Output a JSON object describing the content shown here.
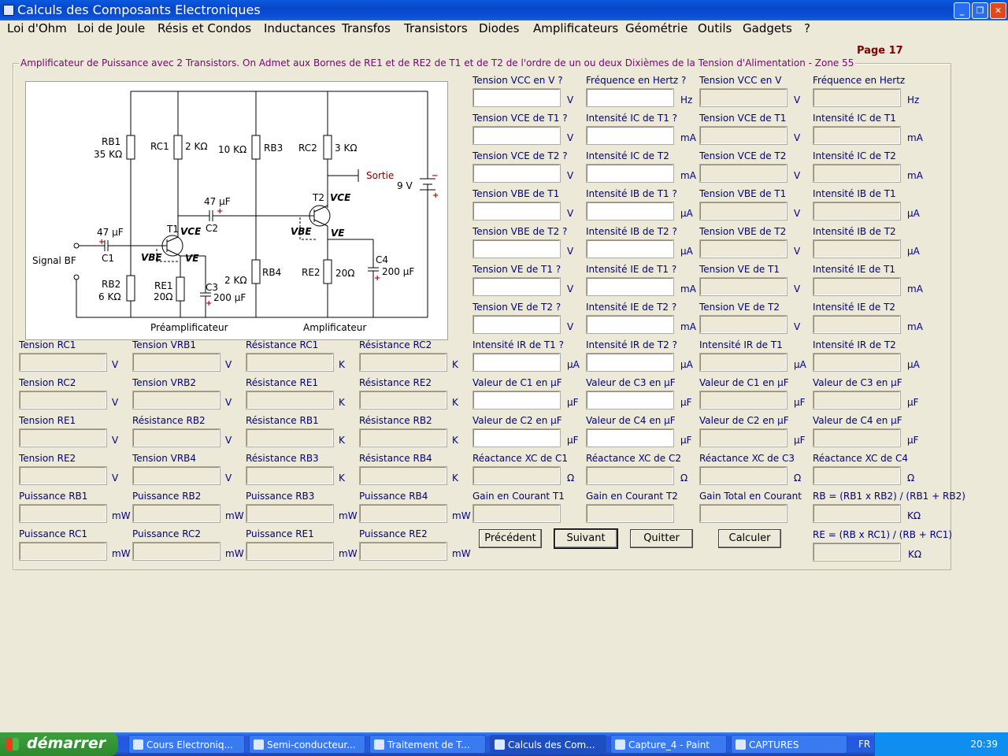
{
  "window": {
    "title": "Calculs des Composants Electroniques"
  },
  "menu": [
    "Loi d'Ohm",
    "Loi de Joule",
    "Résis et Condos",
    "Inductances",
    "Transfos",
    "Transistors",
    "Diodes",
    "Amplificateurs",
    "Géométrie",
    "Outils",
    "Gadgets",
    "?"
  ],
  "page_label": "Page 17",
  "group_title": "Amplificateur de Puissance avec 2 Transistors. On Admet aux Bornes de RE1 et de RE2 de T1 et de T2 de l'ordre de un ou deux Dixièmes de la Tension d'Alimentation - Zone 55",
  "circuit": {
    "labels": [
      "RB1",
      "35 KΩ",
      "RC1",
      "2 KΩ",
      "10 KΩ",
      "RB3",
      "RC2",
      "3 KΩ",
      "Sortie",
      "9 V",
      "T2",
      "VCE",
      "47 µF",
      "C2",
      "47 µF",
      "C1",
      "T1",
      "VCE",
      "VBE",
      "VE",
      "Signal BF",
      "RB2",
      "6 KΩ",
      "RE1",
      "20Ω",
      "C3",
      "200 µF",
      "2 KΩ",
      "RB4",
      "VBE",
      "VE",
      "RE2",
      "20Ω",
      "C4",
      "200 µF",
      "Préamplificateur",
      "Amplificateur"
    ]
  },
  "right_rows": [
    {
      "cells": [
        {
          "label": "Tension VCC en V ?",
          "unit": "V",
          "editable": true
        },
        {
          "label": "Fréquence en Hertz ?",
          "unit": "Hz",
          "editable": true
        },
        {
          "label": "Tension VCC en V",
          "unit": "V",
          "editable": false
        },
        {
          "label": "Fréquence en Hertz",
          "unit": "Hz",
          "editable": false
        }
      ]
    },
    {
      "cells": [
        {
          "label": "Tension VCE de T1 ?",
          "unit": "V",
          "editable": true
        },
        {
          "label": "Intensité IC de T1 ?",
          "unit": "mA",
          "editable": true
        },
        {
          "label": "Tension VCE de T1",
          "unit": "V",
          "editable": false
        },
        {
          "label": "Intensité IC de T1",
          "unit": "mA",
          "editable": false
        }
      ]
    },
    {
      "cells": [
        {
          "label": "Tension VCE de T2 ?",
          "unit": "V",
          "editable": true
        },
        {
          "label": "Intensité IC de T2",
          "unit": "mA",
          "editable": true
        },
        {
          "label": "Tension VCE de T2",
          "unit": "V",
          "editable": false
        },
        {
          "label": "Intensité IC de T2",
          "unit": "mA",
          "editable": false
        }
      ]
    },
    {
      "cells": [
        {
          "label": "Tension VBE de T1",
          "unit": "V",
          "editable": true
        },
        {
          "label": "Intensité IB de T1 ?",
          "unit": "µA",
          "editable": true
        },
        {
          "label": "Tension VBE de T1",
          "unit": "V",
          "editable": false
        },
        {
          "label": "Intensité IB de T1",
          "unit": "µA",
          "editable": false
        }
      ]
    },
    {
      "cells": [
        {
          "label": "Tension VBE de T2 ?",
          "unit": "V",
          "editable": true
        },
        {
          "label": "Intensité IB de T2 ?",
          "unit": "µA",
          "editable": true
        },
        {
          "label": "Tension VBE de T2",
          "unit": "V",
          "editable": false
        },
        {
          "label": "Intensité IB de T2",
          "unit": "µA",
          "editable": false
        }
      ]
    },
    {
      "cells": [
        {
          "label": "Tension VE de T1 ?",
          "unit": "V",
          "editable": true
        },
        {
          "label": "Intensité IE de T1 ?",
          "unit": "mA",
          "editable": true
        },
        {
          "label": "Tension VE de T1",
          "unit": "V",
          "editable": false
        },
        {
          "label": "Intensité IE de T1",
          "unit": "mA",
          "editable": false
        }
      ]
    },
    {
      "cells": [
        {
          "label": "Tension VE de T2 ?",
          "unit": "V",
          "editable": true
        },
        {
          "label": "Intensité IE de T2 ?",
          "unit": "mA",
          "editable": true
        },
        {
          "label": "Tension VE de T2",
          "unit": "V",
          "editable": false
        },
        {
          "label": "Intensité IE de T2",
          "unit": "mA",
          "editable": false
        }
      ]
    },
    {
      "cells": [
        {
          "label": "Intensité IR de T1 ?",
          "unit": "µA",
          "editable": true
        },
        {
          "label": "Intensité IR de T2 ?",
          "unit": "µA",
          "editable": true
        },
        {
          "label": "Intensité IR de T1",
          "unit": "µA",
          "editable": false
        },
        {
          "label": "Intensité IR de T2",
          "unit": "µA",
          "editable": false
        }
      ]
    },
    {
      "cells": [
        {
          "label": "Valeur de C1 en µF",
          "unit": "µF",
          "editable": true
        },
        {
          "label": "Valeur de C3 en µF",
          "unit": "µF",
          "editable": true
        },
        {
          "label": "Valeur de C1 en µF",
          "unit": "µF",
          "editable": false
        },
        {
          "label": "Valeur de C3 en µF",
          "unit": "µF",
          "editable": false
        }
      ]
    },
    {
      "cells": [
        {
          "label": "Valeur de C2 en µF",
          "unit": "µF",
          "editable": true
        },
        {
          "label": "Valeur de C4 en µF",
          "unit": "µF",
          "editable": true
        },
        {
          "label": "Valeur de C2 en µF",
          "unit": "µF",
          "editable": false
        },
        {
          "label": "Valeur de C4 en µF",
          "unit": "µF",
          "editable": false
        }
      ]
    },
    {
      "cells": [
        {
          "label": "Réactance XC de C1",
          "unit": "Ω",
          "editable": false
        },
        {
          "label": "Réactance XC de C2",
          "unit": "Ω",
          "editable": false
        },
        {
          "label": "Réactance XC de C3",
          "unit": "Ω",
          "editable": false
        },
        {
          "label": "Réactance XC de C4",
          "unit": "Ω",
          "editable": false
        }
      ]
    },
    {
      "cells": [
        {
          "label": "Gain en Courant T1",
          "unit": "",
          "editable": false
        },
        {
          "label": "Gain en Courant T2",
          "unit": "",
          "editable": false
        },
        {
          "label": "Gain Total en Courant",
          "unit": "",
          "editable": false
        },
        {
          "label": "RB =  (RB1 x RB2) / (RB1 + RB2)",
          "unit": "KΩ",
          "editable": false
        }
      ]
    }
  ],
  "re_formula": {
    "label": "RE = (RB x RC1) / (RB + RC1)",
    "unit": "KΩ"
  },
  "left_rows": [
    {
      "cells": [
        {
          "label": "Tension RC1",
          "unit": "V"
        },
        {
          "label": "Tension VRB1",
          "unit": "V"
        },
        {
          "label": "Résistance RC1",
          "unit": "K"
        },
        {
          "label": "Résistance RC2",
          "unit": "K"
        }
      ]
    },
    {
      "cells": [
        {
          "label": "Tension RC2",
          "unit": "V"
        },
        {
          "label": "Tension VRB2",
          "unit": "V"
        },
        {
          "label": "Résistance RE1",
          "unit": "K"
        },
        {
          "label": "Résistance RE2",
          "unit": "K"
        }
      ]
    },
    {
      "cells": [
        {
          "label": "Tension RE1",
          "unit": "V"
        },
        {
          "label": "Résistance RB2",
          "unit": "V"
        },
        {
          "label": "Résistance RB1",
          "unit": "K"
        },
        {
          "label": "Résistance RB2",
          "unit": "K"
        }
      ]
    },
    {
      "cells": [
        {
          "label": "Tension RE2",
          "unit": "V"
        },
        {
          "label": "Tension VRB4",
          "unit": "V"
        },
        {
          "label": "Résistance RB3",
          "unit": "K"
        },
        {
          "label": "Résistance RB4",
          "unit": "K"
        }
      ]
    },
    {
      "cells": [
        {
          "label": "Puissance RB1",
          "unit": "mW"
        },
        {
          "label": "Puissance RB2",
          "unit": "mW"
        },
        {
          "label": "Puissance RB3",
          "unit": "mW"
        },
        {
          "label": "Puissance RB4",
          "unit": "mW"
        }
      ]
    },
    {
      "cells": [
        {
          "label": "Puissance RC1",
          "unit": "mW"
        },
        {
          "label": "Puissance RC2",
          "unit": "mW"
        },
        {
          "label": "Puissance RE1",
          "unit": "mW"
        },
        {
          "label": "Puissance RE2",
          "unit": "mW"
        }
      ]
    }
  ],
  "buttons": {
    "previous": "Précédent",
    "next": "Suivant",
    "quit": "Quitter",
    "compute": "Calculer"
  },
  "taskbar": {
    "start": "démarrer",
    "tasks": [
      "Cours Electroniq...",
      "Semi-conducteur...",
      "Traitement de T...",
      "Calculs des Com...",
      "Capture_4 - Paint",
      "CAPTURES"
    ],
    "lang": "FR",
    "clock": "20:39"
  }
}
